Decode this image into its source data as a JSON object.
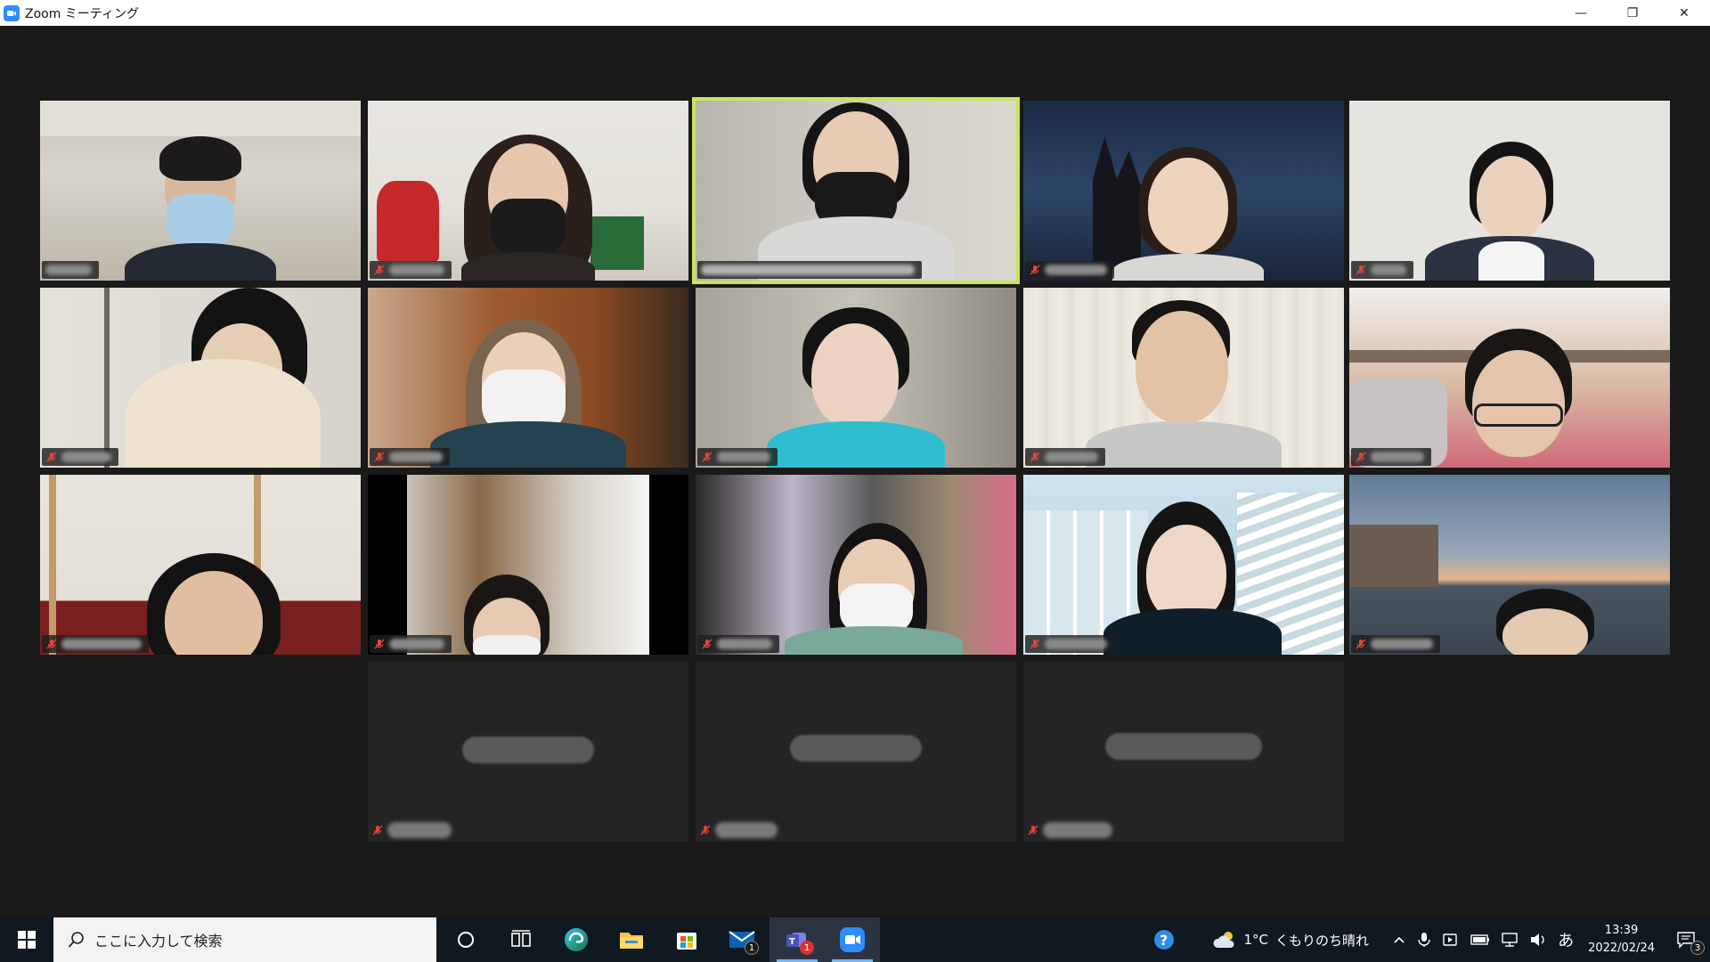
{
  "window": {
    "title": "Zoom ミーティング",
    "minimize": "—",
    "restore": "❐",
    "close": "✕"
  },
  "colors": {
    "active_speaker_border": "#c8e65a",
    "meeting_bg": "#1a1a1a",
    "taskbar_bg": "#101820",
    "zoom_blue": "#2d8cff"
  },
  "participants_count": 18,
  "taskbar": {
    "search_placeholder": "ここに入力して検索",
    "weather_temp": "1°C",
    "weather_text": "くもりのち晴れ",
    "ime_indicator": "あ",
    "time": "13:39",
    "date": "2022/02/24",
    "notification_count": "3",
    "mail_badge": "1",
    "teams_badge": "1"
  }
}
